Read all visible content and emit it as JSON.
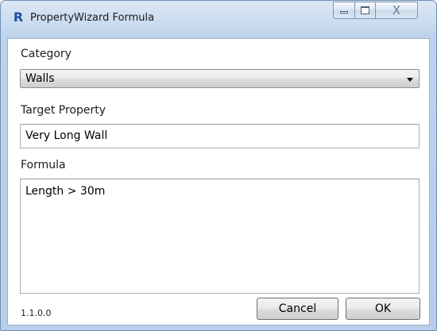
{
  "window": {
    "icon_glyph": "R",
    "icon_name": "revit-app-icon",
    "title": "PropertyWizard Formula",
    "close_glyph": "X"
  },
  "category": {
    "label": "Category",
    "selected": "Walls"
  },
  "target_property": {
    "label": "Target Property",
    "value": "Very Long Wall"
  },
  "formula": {
    "label": "Formula",
    "value": "Length > 30m"
  },
  "footer": {
    "version": "1.1.0.0",
    "cancel_label": "Cancel",
    "ok_label": "OK"
  },
  "colors": {
    "accent_icon": "#1b4f9a",
    "frame": "#bed3ea"
  }
}
